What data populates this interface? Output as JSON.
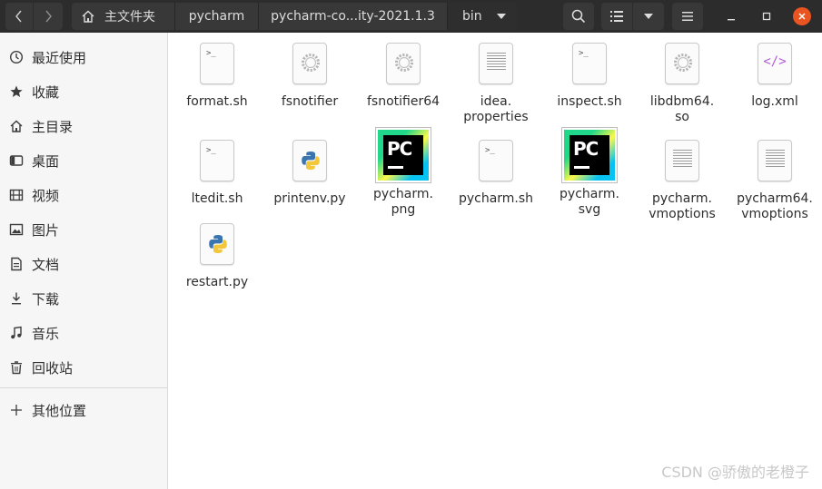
{
  "header": {
    "breadcrumbs": [
      "主文件夹",
      "pycharm",
      "pycharm-co...ity-2021.1.3",
      "bin"
    ]
  },
  "sidebar": {
    "items": [
      {
        "label": "最近使用",
        "icon": "clock-icon"
      },
      {
        "label": "收藏",
        "icon": "star-icon"
      },
      {
        "label": "主目录",
        "icon": "home-icon"
      },
      {
        "label": "桌面",
        "icon": "desktop-icon"
      },
      {
        "label": "视频",
        "icon": "film-icon"
      },
      {
        "label": "图片",
        "icon": "image-icon"
      },
      {
        "label": "文档",
        "icon": "document-icon"
      },
      {
        "label": "下载",
        "icon": "download-icon"
      },
      {
        "label": "音乐",
        "icon": "music-icon"
      },
      {
        "label": "回收站",
        "icon": "trash-icon"
      }
    ],
    "other_locations": "其他位置"
  },
  "files": [
    {
      "name": "format.sh",
      "type": "script"
    },
    {
      "name": "fsnotifier",
      "type": "executable"
    },
    {
      "name": "fsnotifier64",
      "type": "executable"
    },
    {
      "name": "idea.\nproperties",
      "type": "text"
    },
    {
      "name": "inspect.sh",
      "type": "script"
    },
    {
      "name": "libdbm64.\nso",
      "type": "executable"
    },
    {
      "name": "log.xml",
      "type": "xml"
    },
    {
      "name": "ltedit.sh",
      "type": "script"
    },
    {
      "name": "printenv.py",
      "type": "python"
    },
    {
      "name": "pycharm.\npng",
      "type": "pycharm-image"
    },
    {
      "name": "pycharm.sh",
      "type": "script"
    },
    {
      "name": "pycharm.\nsvg",
      "type": "pycharm-image"
    },
    {
      "name": "pycharm.\nvmoptions",
      "type": "text"
    },
    {
      "name": "pycharm64.\nvmoptions",
      "type": "text"
    },
    {
      "name": "restart.py",
      "type": "python"
    }
  ],
  "watermark": "CSDN @骄傲的老橙子",
  "colors": {
    "headerbar": "#2c2c2c",
    "close_button": "#e95420",
    "sidebar": "#f6f6f6"
  }
}
